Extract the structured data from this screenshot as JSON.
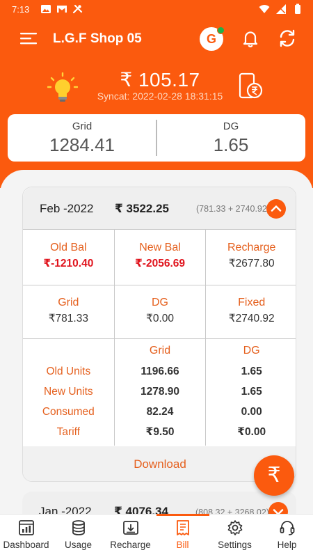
{
  "status_bar": {
    "time": "7:13"
  },
  "toolbar": {
    "title": "L.G.F Shop 05",
    "avatar_letter": "G"
  },
  "summary": {
    "balance": "₹ 105.17",
    "syncat": "Syncat: 2022-02-28 18:31:15"
  },
  "meters": {
    "grid_label": "Grid",
    "grid_value": "1284.41",
    "dg_label": "DG",
    "dg_value": "1.65"
  },
  "bill": {
    "month": "Feb -2022",
    "total": "₹ 3522.25",
    "breakdown": "(781.33 + 2740.92)",
    "balances": {
      "old_bal_label": "Old Bal",
      "old_bal_value": "₹-1210.40",
      "new_bal_label": "New Bal",
      "new_bal_value": "₹-2056.69",
      "recharge_label": "Recharge",
      "recharge_value": "₹2677.80"
    },
    "charges": {
      "grid_label": "Grid",
      "grid_value": "₹781.33",
      "dg_label": "DG",
      "dg_value": "₹0.00",
      "fixed_label": "Fixed",
      "fixed_value": "₹2740.92"
    },
    "units": {
      "col_grid": "Grid",
      "col_dg": "DG",
      "rows": [
        {
          "label": "Old Units",
          "grid": "1196.66",
          "dg": "1.65"
        },
        {
          "label": "New Units",
          "grid": "1278.90",
          "dg": "1.65"
        },
        {
          "label": "Consumed",
          "grid": "82.24",
          "dg": "0.00"
        },
        {
          "label": "Tariff",
          "grid": "₹9.50",
          "dg": "₹0.00"
        }
      ]
    },
    "download_label": "Download"
  },
  "next_bill": {
    "month": "Jan -2022",
    "total": "₹ 4076.34",
    "breakdown": "(808.32 + 3268.02)"
  },
  "fab": {
    "symbol": "₹"
  },
  "nav": {
    "items": [
      {
        "label": "Dashboard",
        "icon": "dashboard-icon"
      },
      {
        "label": "Usage",
        "icon": "database-icon"
      },
      {
        "label": "Recharge",
        "icon": "recharge-icon"
      },
      {
        "label": "Bill",
        "icon": "bill-icon"
      },
      {
        "label": "Settings",
        "icon": "gear-icon"
      },
      {
        "label": "Help",
        "icon": "headset-icon"
      }
    ],
    "active": "Bill"
  },
  "colors": {
    "brand": "#fb5a0e",
    "label": "#e5601e",
    "negative": "#e0131c"
  }
}
